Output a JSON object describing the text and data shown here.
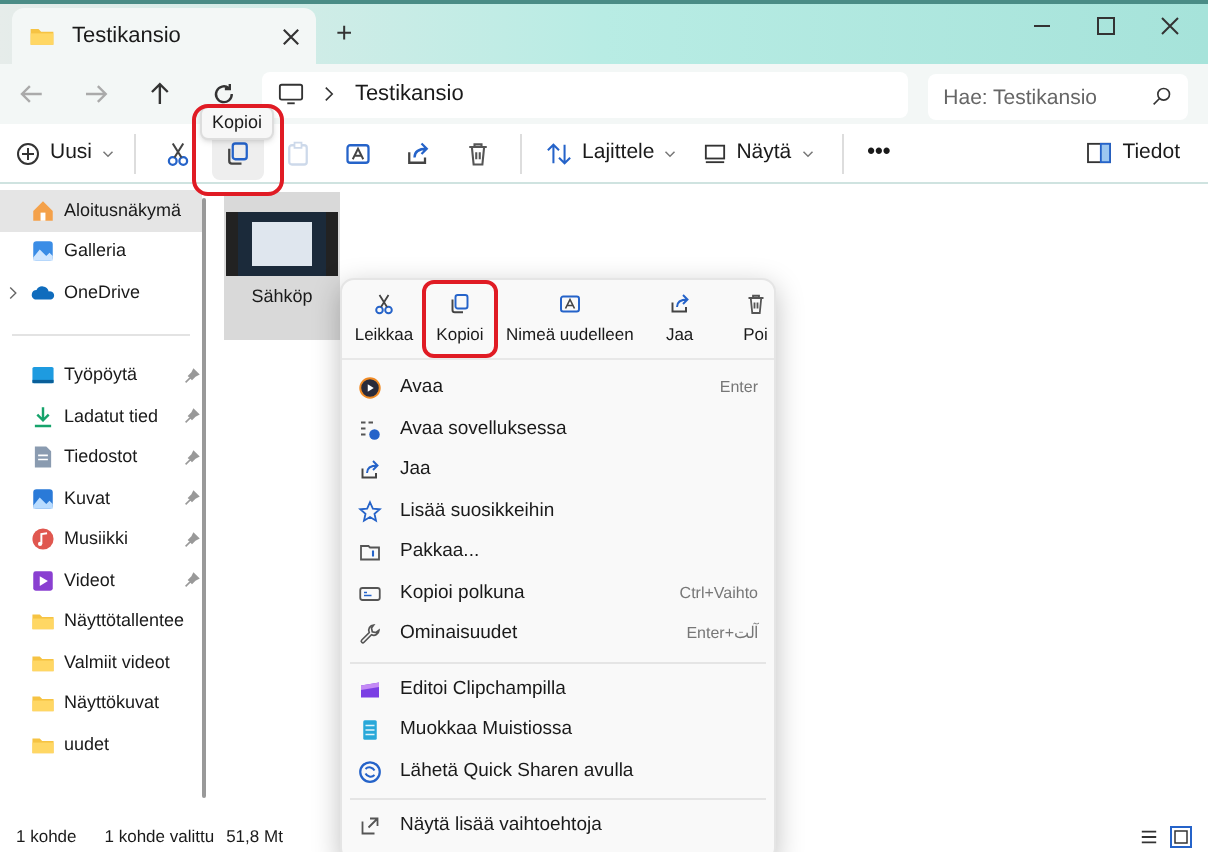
{
  "window": {
    "tab_title": "Testikansio",
    "new_tab": "+"
  },
  "nav": {
    "path": "Testikansio",
    "search_placeholder": "Hae: Testikansio"
  },
  "toolbar": {
    "new": "Uusi",
    "sort": "Lajittele",
    "view": "Näytä",
    "more": "•••",
    "details": "Tiedot",
    "tooltip": "Kopioi",
    "actions": [
      {
        "kind": "cut",
        "disabled": false,
        "hovered": false,
        "highlighted": false
      },
      {
        "kind": "copy",
        "disabled": false,
        "hovered": true,
        "highlighted": true
      },
      {
        "kind": "paste",
        "disabled": true,
        "hovered": false,
        "highlighted": false
      },
      {
        "kind": "rename",
        "disabled": false,
        "hovered": false,
        "highlighted": false
      },
      {
        "kind": "share",
        "disabled": false,
        "hovered": false,
        "highlighted": false
      },
      {
        "kind": "delete",
        "disabled": false,
        "hovered": false,
        "highlighted": false
      }
    ]
  },
  "sidebar": {
    "groups": [
      [
        {
          "kind": "home",
          "label": "Aloitusnäkymä",
          "selected": true,
          "pinned": false,
          "expandable": false
        },
        {
          "kind": "gallery",
          "label": "Galleria",
          "selected": false,
          "pinned": false,
          "expandable": false
        },
        {
          "kind": "cloud",
          "label": "OneDrive",
          "selected": false,
          "pinned": false,
          "expandable": true
        }
      ],
      [
        {
          "kind": "desktop",
          "label": "Työpöytä",
          "selected": false,
          "pinned": true,
          "expandable": false
        },
        {
          "kind": "download",
          "label": "Ladatut tied",
          "selected": false,
          "pinned": true,
          "expandable": false
        },
        {
          "kind": "document",
          "label": "Tiedostot",
          "selected": false,
          "pinned": true,
          "expandable": false
        },
        {
          "kind": "pictures",
          "label": "Kuvat",
          "selected": false,
          "pinned": true,
          "expandable": false
        },
        {
          "kind": "music",
          "label": "Musiikki",
          "selected": false,
          "pinned": true,
          "expandable": false
        },
        {
          "kind": "video",
          "label": "Videot",
          "selected": false,
          "pinned": true,
          "expandable": false
        },
        {
          "kind": "folder",
          "label": "Näyttötallentee",
          "selected": false,
          "pinned": false,
          "expandable": false
        },
        {
          "kind": "folder",
          "label": "Valmiit videot",
          "selected": false,
          "pinned": false,
          "expandable": false
        },
        {
          "kind": "folder",
          "label": "Näyttökuvat",
          "selected": false,
          "pinned": false,
          "expandable": false
        },
        {
          "kind": "folder",
          "label": "uudet",
          "selected": false,
          "pinned": false,
          "expandable": false
        }
      ]
    ]
  },
  "files": [
    {
      "name": "Sähköp",
      "selected": true
    }
  ],
  "context_menu": {
    "quick_actions": [
      {
        "kind": "cut",
        "label": "Leikkaa",
        "highlighted": false
      },
      {
        "kind": "copy",
        "label": "Kopioi",
        "highlighted": true
      },
      {
        "kind": "rename",
        "label": "Nimeä uudelleen",
        "highlighted": false
      },
      {
        "kind": "share",
        "label": "Jaa",
        "highlighted": false
      },
      {
        "kind": "delete",
        "label": "Poi",
        "highlighted": false
      }
    ],
    "groups": [
      [
        {
          "kind": "play",
          "label": "Avaa",
          "shortcut": "Enter"
        },
        {
          "kind": "openwith",
          "label": "Avaa sovelluksessa"
        },
        {
          "kind": "share",
          "label": "Jaa"
        },
        {
          "kind": "star",
          "label": "Lisää suosikkeihin"
        },
        {
          "kind": "zip",
          "label": "Pakkaa..."
        },
        {
          "kind": "path",
          "label": "Kopioi polkuna",
          "shortcut": "Ctrl+Vaihto"
        },
        {
          "kind": "wrench",
          "label": "Ominaisuudet",
          "shortcut": "Enter+آلت"
        }
      ],
      [
        {
          "kind": "clipchamp",
          "label": "Editoi Clipchampilla"
        },
        {
          "kind": "notepad",
          "label": "Muokkaa Muistiossa"
        },
        {
          "kind": "quickshare",
          "label": "Lähetä Quick Sharen avulla"
        }
      ],
      [
        {
          "kind": "more",
          "label": "Näytä lisää vaihtoehtoja"
        }
      ]
    ]
  },
  "status_bar": {
    "count": "1 kohde",
    "selection": "1 kohde valittu",
    "size": "51,8 Mt"
  }
}
